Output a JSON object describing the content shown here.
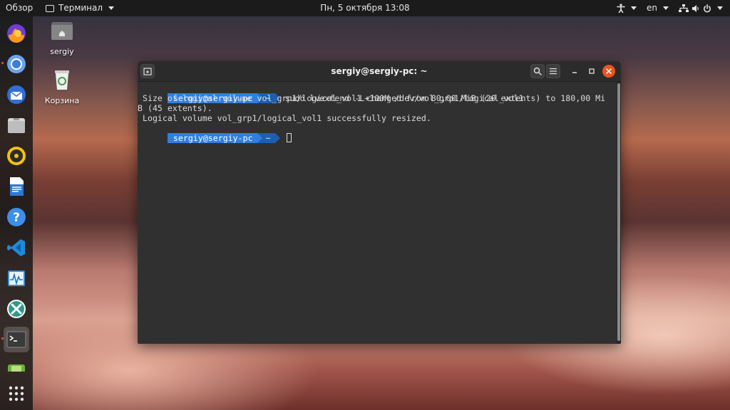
{
  "topbar": {
    "overview": "Обзор",
    "app_name": "Терминал",
    "clock": "Пн, 5 октября  13:08",
    "language": "en",
    "icons": [
      "accessibility-icon",
      "network-icon",
      "power-icon"
    ]
  },
  "dock": {
    "apps": [
      "firefox-icon",
      "chromium-icon",
      "thunderbird-icon",
      "files-icon",
      "rhythmbox-icon",
      "libreoffice-writer-icon",
      "help-icon",
      "vscode-icon",
      "system-monitor-icon",
      "crossover-icon",
      "terminal-icon",
      "app-icon",
      "show-apps-icon"
    ],
    "active": "terminal-icon"
  },
  "desktop": {
    "home_label": "sergiy",
    "trash_label": "Корзина"
  },
  "window": {
    "title": "sergiy@sergiy-pc: ~",
    "prompt_user": "sergiy@sergiy-pc",
    "prompt_dir": "~",
    "command": "sudo lvextend -L+100M /dev/vol_grp1/logical_vol1",
    "output_1": " Size of logical volume vol_grp1/logical_vol1 changed from 80,00 MiB (20 extents) to 180,00 Mi",
    "output_2": "B (45 extents).",
    "output_3": " Logical volume vol_grp1/logical_vol1 successfully resized."
  },
  "colors": {
    "prompt_user_bg": "#2f7fe0",
    "prompt_dir_bg": "#1d5fae",
    "close_button": "#e95420",
    "terminal_bg": "#303030"
  }
}
